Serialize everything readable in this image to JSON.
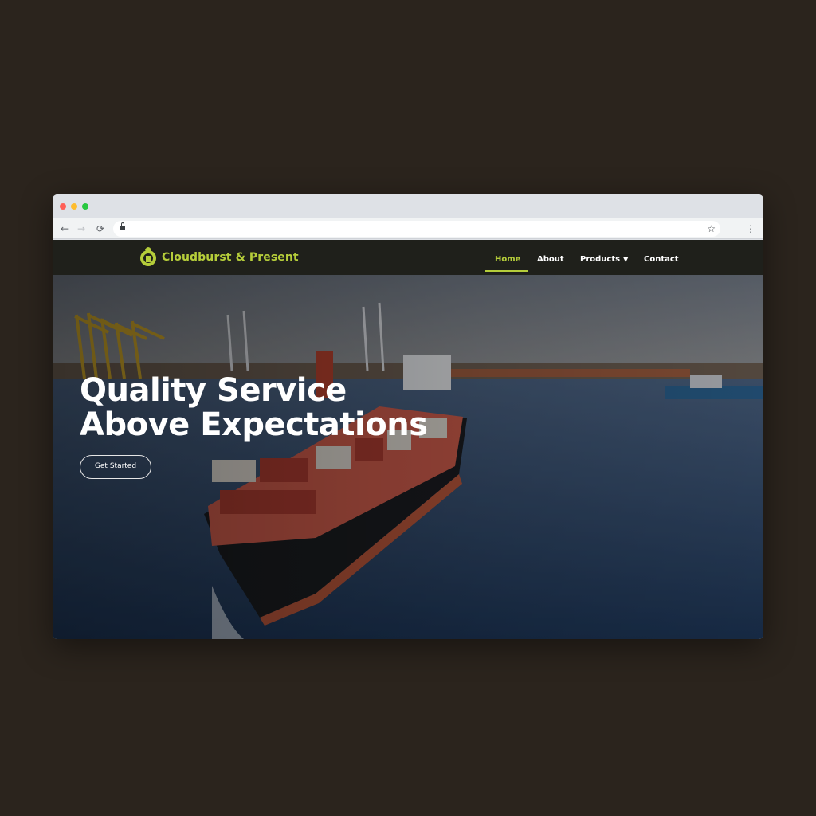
{
  "browser": {
    "controls": {
      "back": "←",
      "forward": "→",
      "reload": "⟳",
      "star": "☆",
      "menu": "⋮"
    }
  },
  "site": {
    "brand": "Cloudburst & Present",
    "nav": {
      "home": "Home",
      "about": "About",
      "products": "Products",
      "contact": "Contact"
    },
    "hero": {
      "headline_line1": "Quality Service",
      "headline_line2": "Above Expectations",
      "cta_label": "Get Started"
    }
  },
  "colors": {
    "backdrop": "#2b241d",
    "header_bg": "#1f201b",
    "accent": "#b5cd3a",
    "text": "#ffffff"
  },
  "icons": {
    "logo": "rooster-logo-icon",
    "lock": "lock-icon",
    "star": "bookmark-star-icon",
    "menu": "more-vert-icon",
    "caret": "chevron-down-icon"
  }
}
